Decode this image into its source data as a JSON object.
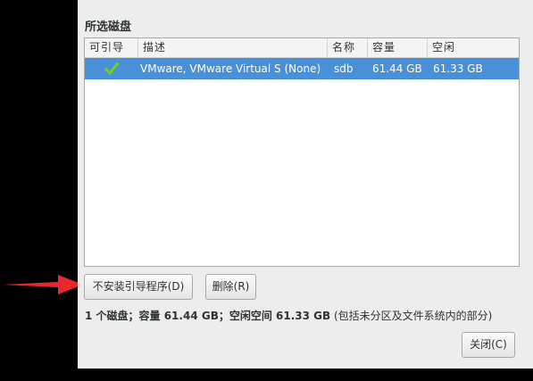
{
  "section_title": "所选磁盘",
  "table": {
    "columns": [
      "可引导",
      "描述",
      "名称",
      "容量",
      "空闲"
    ],
    "rows": [
      {
        "bootable": true,
        "description": "VMware, VMware Virtual S (None)",
        "name": "sdb",
        "capacity": "61.44 GB",
        "free": "61.33 GB"
      }
    ]
  },
  "buttons": {
    "no_bootloader": "不安装引导程序(D)",
    "delete": "删除(R)",
    "close": "关闭(C)"
  },
  "summary": {
    "bold": "1 个磁盘；容量 61.44 GB；空闲空间 61.33 GB",
    "normal": " (包括未分区及文件系统内的部分)"
  },
  "colors": {
    "selection": "#4a90d9",
    "checkmark": "#73d216",
    "arrow": "#e8292c"
  },
  "icons": {
    "bootable_check": "checkmark-icon",
    "pointer": "red-arrow"
  }
}
